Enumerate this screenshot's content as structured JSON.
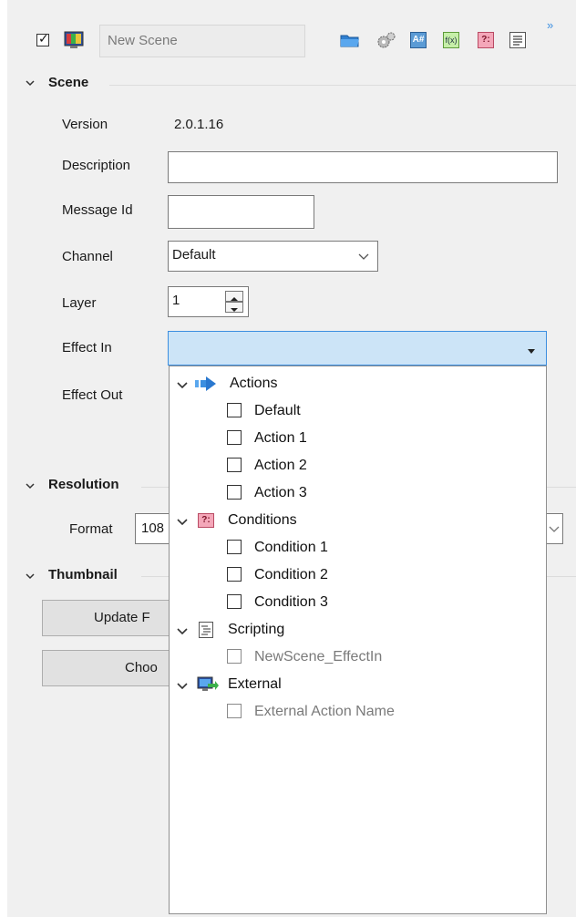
{
  "toolbar": {
    "scene_name": "New Scene",
    "icons": [
      "visible-checkbox",
      "monitor-icon",
      "folder-icon",
      "gear-icon",
      "text-field-icon",
      "function-icon",
      "condition-icon",
      "script-icon",
      "overflow-icon"
    ],
    "text_icon_label": "A#",
    "func_icon_label": "f(x)",
    "cond_icon_label": "?:",
    "overflow_label": "»"
  },
  "scene": {
    "header": "Scene",
    "version_label": "Version",
    "version_value": "2.0.1.16",
    "description_label": "Description",
    "description_value": "",
    "message_id_label": "Message Id",
    "message_id_value": "",
    "channel_label": "Channel",
    "channel_value": "Default",
    "layer_label": "Layer",
    "layer_value": "1",
    "effect_in_label": "Effect In",
    "effect_in_value": "",
    "effect_out_label": "Effect Out"
  },
  "resolution": {
    "header": "Resolution",
    "format_label": "Format",
    "format_value_visible": "108"
  },
  "thumbnail": {
    "header": "Thumbnail",
    "update_button_visible": "Update F",
    "choose_button_visible": "Choo"
  },
  "effect_dropdown": {
    "groups": [
      {
        "label": "Actions",
        "icon": "arrow-icon",
        "items": [
          {
            "label": "Default",
            "enabled": true
          },
          {
            "label": "Action 1",
            "enabled": true
          },
          {
            "label": "Action 2",
            "enabled": true
          },
          {
            "label": "Action 3",
            "enabled": true
          }
        ]
      },
      {
        "label": "Conditions",
        "icon": "condition-icon",
        "items": [
          {
            "label": "Condition 1",
            "enabled": true
          },
          {
            "label": "Condition 2",
            "enabled": true
          },
          {
            "label": "Condition 3",
            "enabled": true
          }
        ]
      },
      {
        "label": "Scripting",
        "icon": "script-icon",
        "items": [
          {
            "label": "NewScene_EffectIn",
            "enabled": false
          }
        ]
      },
      {
        "label": "External",
        "icon": "external-icon",
        "items": [
          {
            "label": "External Action Name",
            "enabled": false
          }
        ]
      }
    ]
  },
  "colors": {
    "accent": "#3c8fe0",
    "dropdown_active_bg": "#cce4f7",
    "condition_badge": "#f4a7b9"
  }
}
